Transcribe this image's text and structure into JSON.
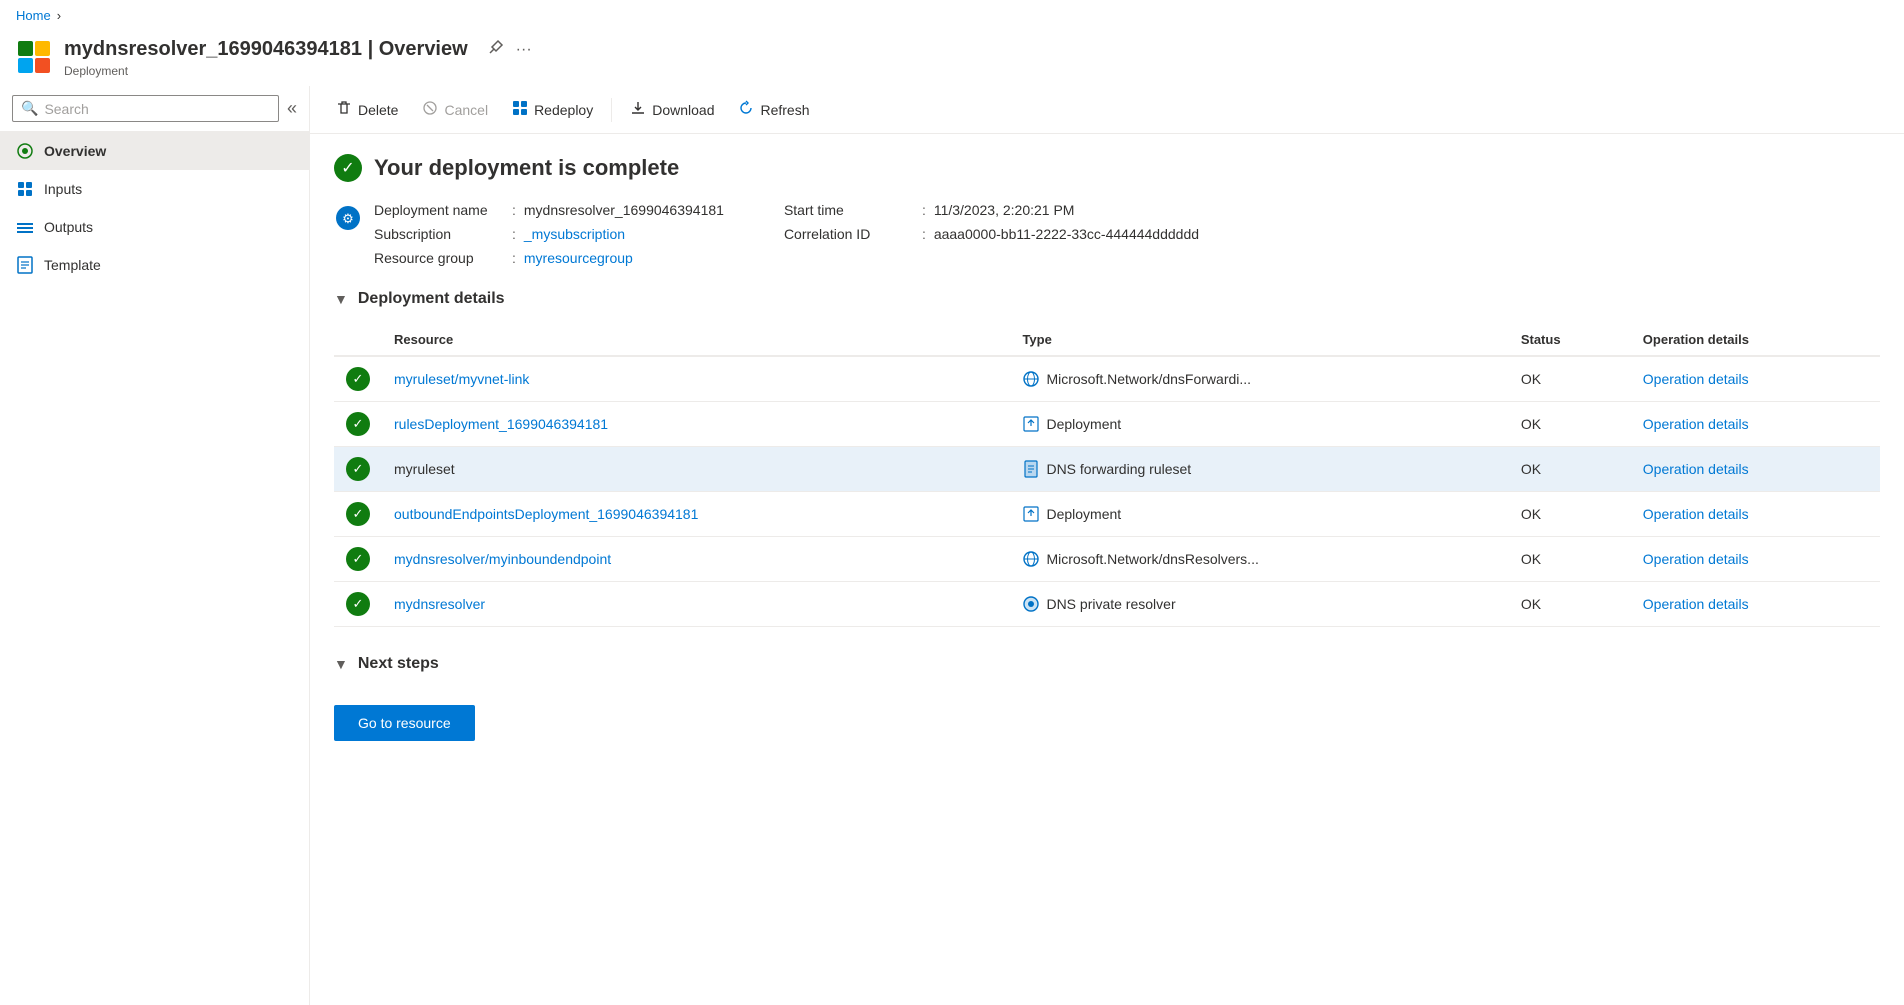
{
  "breadcrumb": {
    "home_label": "Home",
    "separator": "›"
  },
  "header": {
    "title": "mydnsresolver_1699046394181 | Overview",
    "subtitle": "Deployment",
    "pin_label": "📌",
    "more_label": "···"
  },
  "sidebar": {
    "search_placeholder": "Search",
    "collapse_icon": "«",
    "nav_items": [
      {
        "id": "overview",
        "label": "Overview",
        "active": true
      },
      {
        "id": "inputs",
        "label": "Inputs",
        "active": false
      },
      {
        "id": "outputs",
        "label": "Outputs",
        "active": false
      },
      {
        "id": "template",
        "label": "Template",
        "active": false
      }
    ]
  },
  "toolbar": {
    "delete_label": "Delete",
    "cancel_label": "Cancel",
    "redeploy_label": "Redeploy",
    "download_label": "Download",
    "refresh_label": "Refresh"
  },
  "success": {
    "title": "Your deployment is complete"
  },
  "deployment_info": {
    "left": {
      "name_label": "Deployment name",
      "name_value": "mydnsresolver_1699046394181",
      "subscription_label": "Subscription",
      "subscription_value": "_mysubscription",
      "resource_group_label": "Resource group",
      "resource_group_value": "myresourcegroup"
    },
    "right": {
      "start_time_label": "Start time",
      "start_time_value": "11/3/2023, 2:20:21 PM",
      "correlation_label": "Correlation ID",
      "correlation_value": "aaaa0000-bb11-2222-33cc-444444dddddd"
    }
  },
  "deployment_details": {
    "section_title": "Deployment details",
    "columns": [
      "Resource",
      "Type",
      "Status",
      "Operation details"
    ],
    "rows": [
      {
        "resource_name": "myruleset/myvnet-link",
        "resource_link": true,
        "type_name": "Microsoft.Network/dnsForwardi...",
        "type_icon": "globe",
        "status": "OK",
        "op_details": "Operation details",
        "highlighted": false
      },
      {
        "resource_name": "rulesDeployment_1699046394181",
        "resource_link": true,
        "type_name": "Deployment",
        "type_icon": "upload",
        "status": "OK",
        "op_details": "Operation details",
        "highlighted": false
      },
      {
        "resource_name": "myruleset",
        "resource_link": false,
        "type_name": "DNS forwarding ruleset",
        "type_icon": "doc",
        "status": "OK",
        "op_details": "Operation details",
        "highlighted": true
      },
      {
        "resource_name": "outboundEndpointsDeployment_1699046394181",
        "resource_link": true,
        "type_name": "Deployment",
        "type_icon": "upload",
        "status": "OK",
        "op_details": "Operation details",
        "highlighted": false
      },
      {
        "resource_name": "mydnsresolver/myinboundendpoint",
        "resource_link": true,
        "type_name": "Microsoft.Network/dnsResolvers...",
        "type_icon": "globe",
        "status": "OK",
        "op_details": "Operation details",
        "highlighted": false
      },
      {
        "resource_name": "mydnsresolver",
        "resource_link": true,
        "type_name": "DNS private resolver",
        "type_icon": "dns-private",
        "status": "OK",
        "op_details": "Operation details",
        "highlighted": false
      }
    ]
  },
  "next_steps": {
    "section_title": "Next steps",
    "go_to_resource_label": "Go to resource"
  }
}
